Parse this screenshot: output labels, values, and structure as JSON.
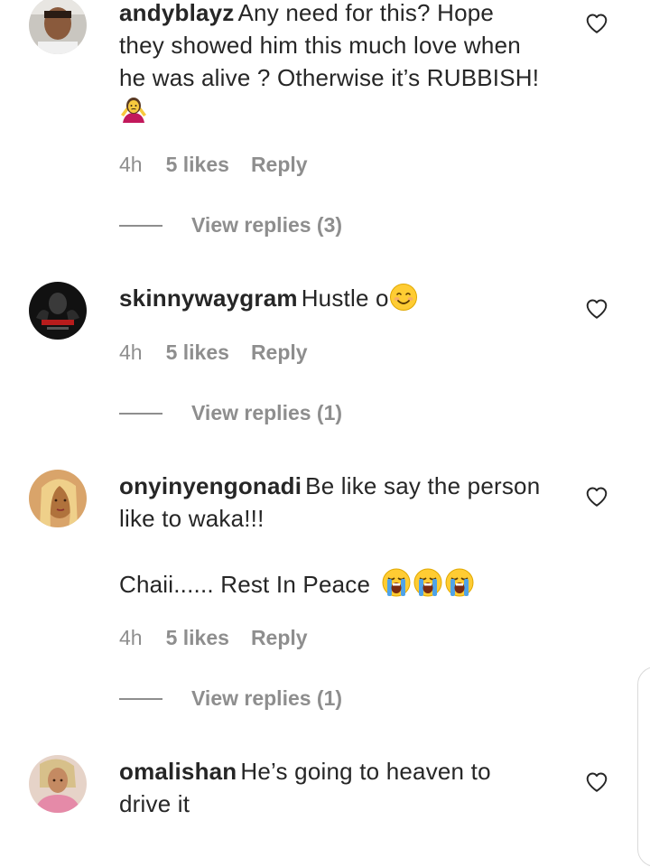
{
  "comments": [
    {
      "username": "andyblayz",
      "lines": [
        "Any need for this? Hope",
        "they showed him this much love when",
        "he was alive ? Otherwise it’s RUBBISH!"
      ],
      "emoji_line": "person-shrugging-emoji",
      "time": "4h",
      "likes": "5 likes",
      "reply": "Reply",
      "view_replies": "View replies (3)"
    },
    {
      "username": "skinnywaygram",
      "lines": [
        "Hustle o"
      ],
      "inline_emoji": "smiling-face-emoji",
      "time": "4h",
      "likes": "5 likes",
      "reply": "Reply",
      "view_replies": "View replies (1)"
    },
    {
      "username": "onyinyengonadi",
      "lines": [
        "Be like say the person",
        "like to waka!!!",
        "Chaii...... Rest In Peace"
      ],
      "inline_emoji": "loudly-crying-face-emoji",
      "time": "4h",
      "likes": "5 likes",
      "reply": "Reply",
      "view_replies": "View replies (1)"
    },
    {
      "username": "omalishan",
      "lines": [
        "He’s going to heaven to",
        "drive it"
      ]
    }
  ],
  "colors": {
    "text": "#262626",
    "muted": "#8e8e8e",
    "background": "#ffffff"
  },
  "icons": {
    "like": "heart-outline-icon"
  }
}
